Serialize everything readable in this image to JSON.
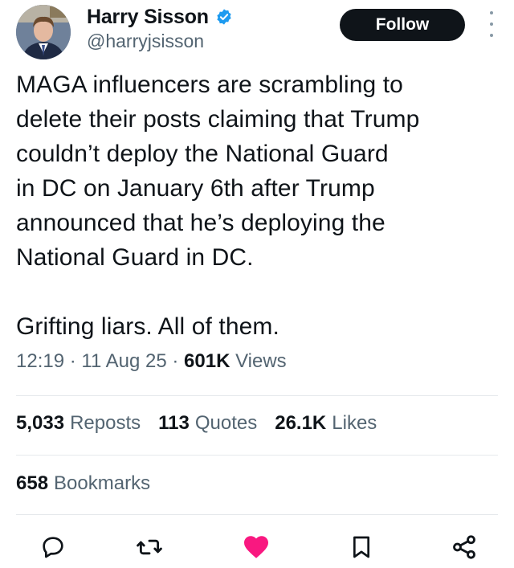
{
  "author": {
    "name": "Harry Sisson",
    "handle": "@harryjsisson",
    "verified": true
  },
  "follow_label": "Follow",
  "tweet": {
    "text": "MAGA influencers are scrambling to\ndelete their posts claiming that Trump\ncouldn’t deploy the National Guard\nin DC on January 6th after Trump\nannounced that he’s deploying the\nNational Guard in DC.\n\nGrifting liars. All of them."
  },
  "meta": {
    "time": "12:19",
    "sep1": " · ",
    "date": "11 Aug 25",
    "sep2": " · ",
    "views_count": "601K",
    "views_label": "Views"
  },
  "stats": {
    "reposts_count": "5,033",
    "reposts_label": "Reposts",
    "quotes_count": "113",
    "quotes_label": "Quotes",
    "likes_count": "26.1K",
    "likes_label": "Likes",
    "bookmarks_count": "658",
    "bookmarks_label": "Bookmarks"
  },
  "actions": [
    "reply-icon",
    "repost-icon",
    "like-icon-filled",
    "bookmark-icon",
    "share-icon"
  ],
  "colors": {
    "text": "#0f1419",
    "secondary": "#536471",
    "verified_blue": "#1d9bf0",
    "like_pink": "#f91880",
    "follow_bg": "#0f1419"
  }
}
